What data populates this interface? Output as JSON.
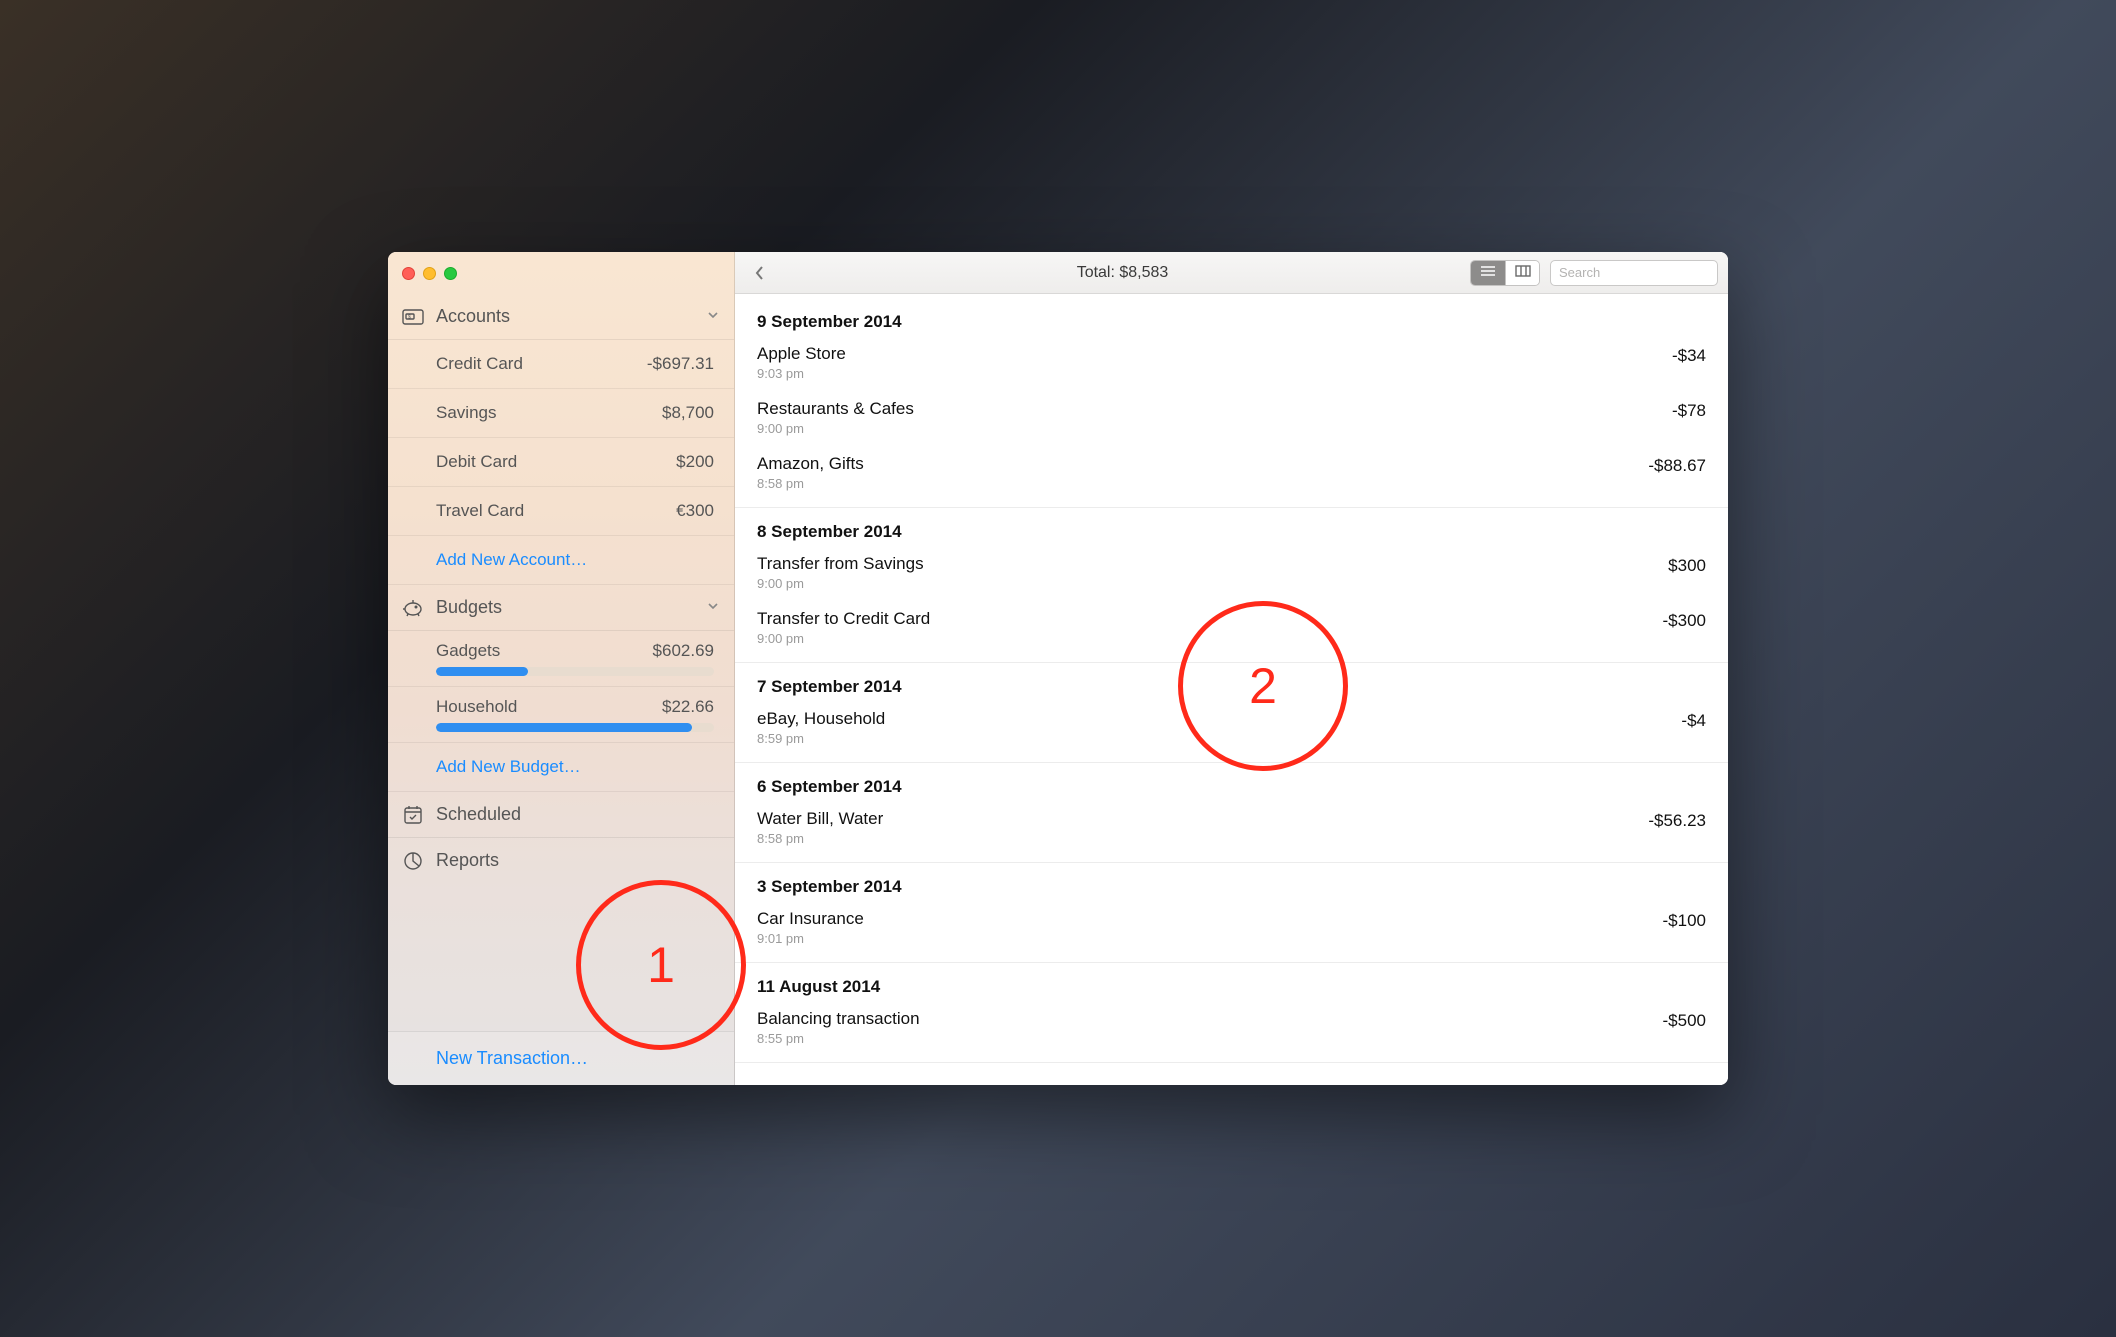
{
  "toolbar": {
    "title": "Total: $8,583",
    "search_placeholder": "Search"
  },
  "sidebar": {
    "accounts_label": "Accounts",
    "budgets_label": "Budgets",
    "scheduled_label": "Scheduled",
    "reports_label": "Reports",
    "add_account_label": "Add New Account…",
    "add_budget_label": "Add New Budget…",
    "new_transaction_label": "New Transaction…",
    "accounts": [
      {
        "name": "Credit Card",
        "amount": "-$697.31"
      },
      {
        "name": "Savings",
        "amount": "$8,700"
      },
      {
        "name": "Debit Card",
        "amount": "$200"
      },
      {
        "name": "Travel Card",
        "amount": "€300"
      }
    ],
    "budgets": [
      {
        "name": "Gadgets",
        "amount": "$602.69",
        "progress": 33
      },
      {
        "name": "Household",
        "amount": "$22.66",
        "progress": 92
      }
    ]
  },
  "transactions": [
    {
      "date": "9 September 2014",
      "items": [
        {
          "title": "Apple Store",
          "time": "9:03 pm",
          "amount": "-$34"
        },
        {
          "title": "Restaurants & Cafes",
          "time": "9:00 pm",
          "amount": "-$78"
        },
        {
          "title": "Amazon, Gifts",
          "time": "8:58 pm",
          "amount": "-$88.67"
        }
      ]
    },
    {
      "date": "8 September 2014",
      "items": [
        {
          "title": "Transfer from Savings",
          "time": "9:00 pm",
          "amount": "$300"
        },
        {
          "title": "Transfer to Credit Card",
          "time": "9:00 pm",
          "amount": "-$300"
        }
      ]
    },
    {
      "date": "7 September 2014",
      "items": [
        {
          "title": "eBay, Household",
          "time": "8:59 pm",
          "amount": "-$4"
        }
      ]
    },
    {
      "date": "6 September 2014",
      "items": [
        {
          "title": "Water Bill, Water",
          "time": "8:58 pm",
          "amount": "-$56.23"
        }
      ]
    },
    {
      "date": "3 September 2014",
      "items": [
        {
          "title": "Car Insurance",
          "time": "9:01 pm",
          "amount": "-$100"
        }
      ]
    },
    {
      "date": "11 August 2014",
      "items": [
        {
          "title": "Balancing transaction",
          "time": "8:55 pm",
          "amount": "-$500"
        }
      ]
    }
  ],
  "annotations": {
    "one": "1",
    "two": "2"
  }
}
